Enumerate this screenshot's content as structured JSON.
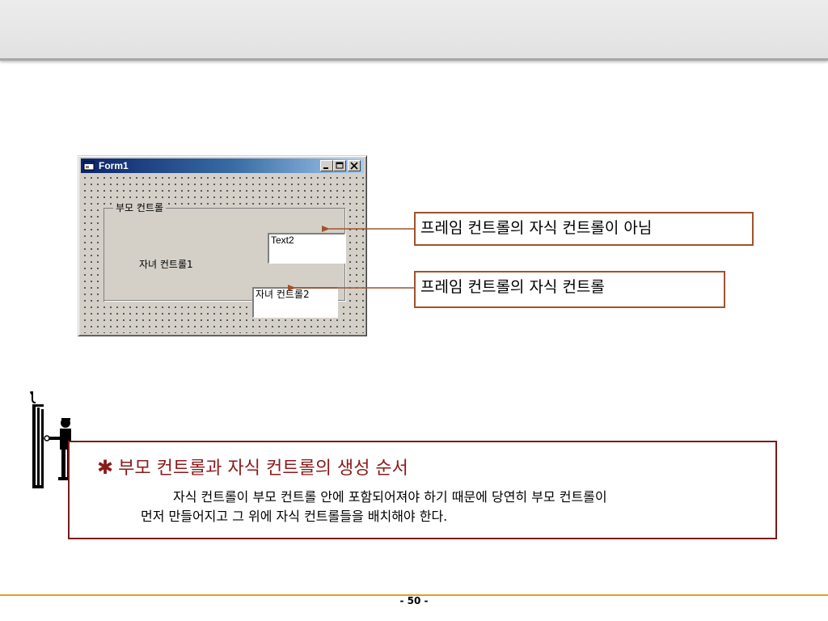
{
  "form": {
    "title": "Form1",
    "frame_caption": "부모 컨트롤",
    "label1": "자녀 컨트롤1",
    "textbox1_value": "Text2",
    "textbox2_value": "자녀 컨트롤2"
  },
  "callouts": {
    "not_child": "프레임 컨트롤의 자식 컨트롤이 아님",
    "is_child": "프레임 컨트롤의 자식 컨트롤"
  },
  "note": {
    "star": "✱",
    "title": "부모 컨트롤과 자식 컨트롤의 생성 순서",
    "line1": "자식 컨트롤이 부모 컨트롤 안에 포함되어져야 하기 때문에 당연히 부모 컨트롤이",
    "line2": "먼저 만들어지고 그 위에 자식 컨트롤들을 배치해야 한다."
  },
  "footer": {
    "page_number": "- 50 -"
  },
  "colors": {
    "callout_border": "#a0522d",
    "note_border": "#7b1a1a",
    "note_title": "#8b1a1a",
    "footer_line": "#e0a020"
  }
}
